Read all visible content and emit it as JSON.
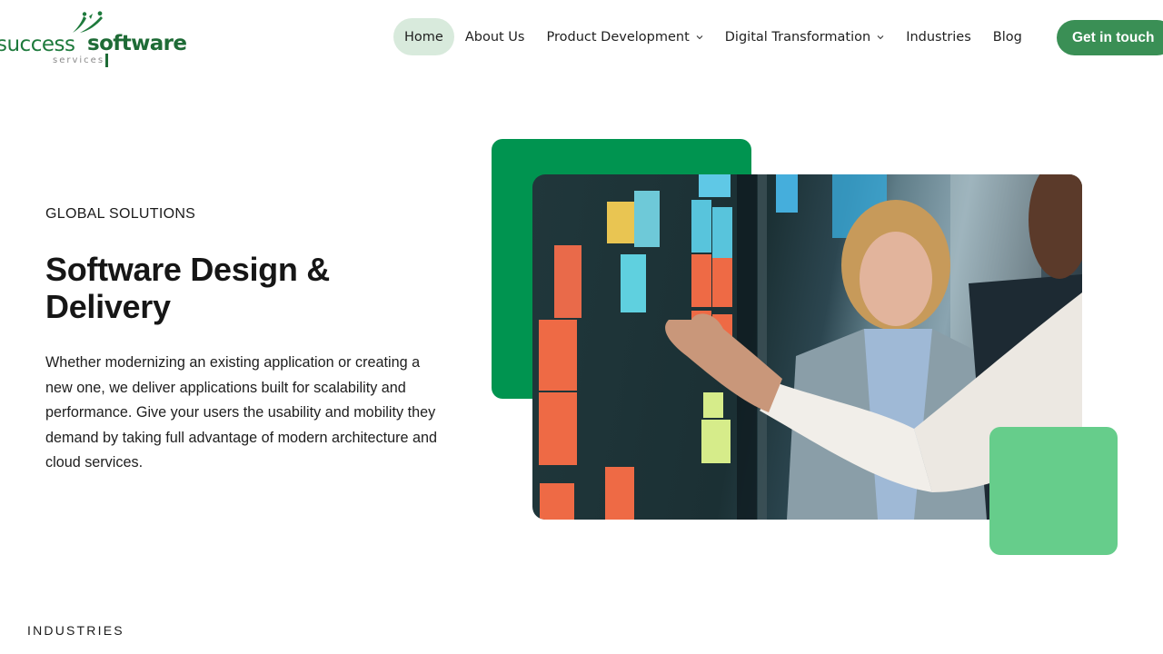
{
  "brand": {
    "logo_word_1": "success",
    "logo_word_2": "software",
    "logo_sub": "services",
    "logo_icon": "leaping-figures-icon",
    "primary_green": "#009450",
    "light_green": "#66cd8b",
    "button_green": "#3a8f55",
    "active_nav_bg": "#d8eadc"
  },
  "nav": {
    "items": [
      {
        "label": "Home",
        "active": true,
        "has_dropdown": false
      },
      {
        "label": "About Us",
        "active": false,
        "has_dropdown": false
      },
      {
        "label": "Product Development",
        "active": false,
        "has_dropdown": true
      },
      {
        "label": "Digital Transformation",
        "active": false,
        "has_dropdown": true
      },
      {
        "label": "Industries",
        "active": false,
        "has_dropdown": false
      },
      {
        "label": "Blog",
        "active": false,
        "has_dropdown": false
      }
    ],
    "cta_label": "Get in touch"
  },
  "hero": {
    "eyebrow": "GLOBAL SOLUTIONS",
    "title": "Software Design & Delivery",
    "body": "Whether modernizing an existing application or creating a new one, we deliver applications built for scalability and performance. Give your users the usability and mobility they demand by taking full advantage of modern architecture and cloud services.",
    "image_alt": "Team members placing sticky notes on a glass board"
  },
  "next_section": {
    "label": "INDUSTRIES"
  }
}
